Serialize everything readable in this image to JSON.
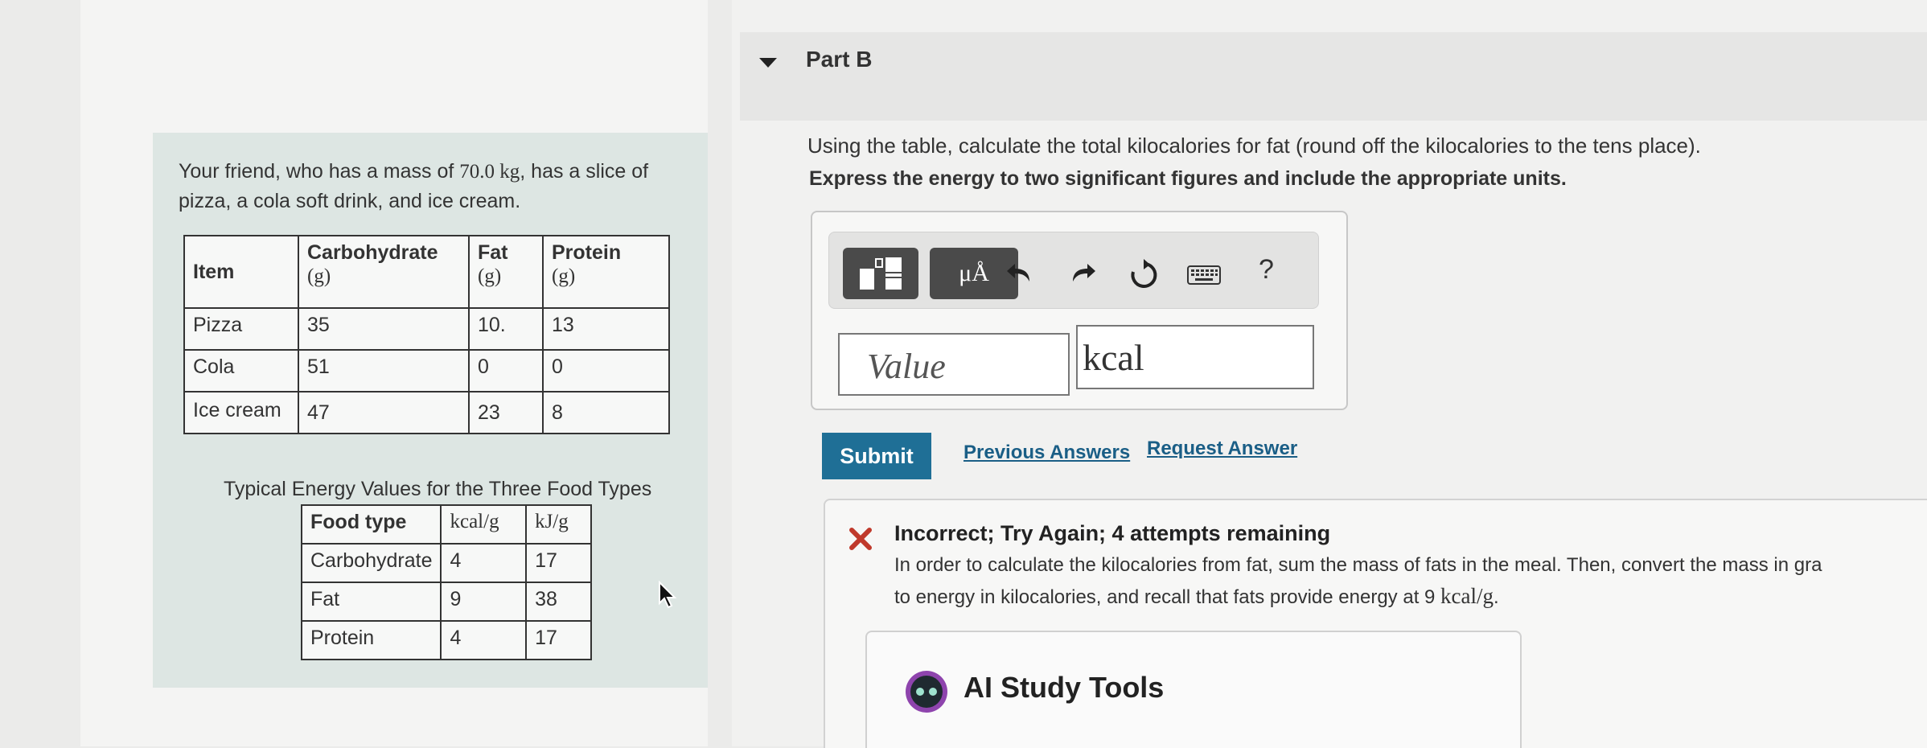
{
  "problem": {
    "intro_before": "Your friend, who has a mass of ",
    "intro_mass": "70.0 kg",
    "intro_after": ", has a slice of pizza, a cola soft drink, and ice cream.",
    "food_table": {
      "headers": [
        {
          "name": "Item",
          "unit": ""
        },
        {
          "name": "Carbohydrate",
          "unit": "(g)"
        },
        {
          "name": "Fat",
          "unit": "(g)"
        },
        {
          "name": "Protein",
          "unit": "(g)"
        }
      ],
      "rows": [
        [
          "Pizza",
          "35",
          "10.",
          "13"
        ],
        [
          "Cola",
          "51",
          "0",
          "0"
        ],
        [
          "Ice cream",
          "47",
          "23",
          "8"
        ]
      ]
    },
    "energy_caption": "Typical Energy Values for the Three Food Types",
    "energy_table": {
      "headers": [
        "Food type",
        "kcal/g",
        "kJ/g"
      ],
      "rows": [
        [
          "Carbohydrate",
          "4",
          "17"
        ],
        [
          "Fat",
          "9",
          "38"
        ],
        [
          "Protein",
          "4",
          "17"
        ]
      ]
    }
  },
  "part": {
    "title": "Part B",
    "question": "Using the table, calculate the total kilocalories for fat (round off the kilocalories to the tens place).",
    "instruction": "Express the energy to two significant figures and include the appropriate units."
  },
  "toolbar": {
    "units_label": "μÅ",
    "help_label": "?"
  },
  "answer": {
    "value_placeholder": "Value",
    "unit_value": "kcal"
  },
  "actions": {
    "submit_label": "Submit",
    "previous_answers_label": "Previous Answers",
    "request_answer_label": "Request Answer"
  },
  "feedback": {
    "title": "Incorrect; Try Again; 4 attempts remaining",
    "line1": "In order to calculate the kilocalories from fat, sum the mass of fats in the meal. Then, convert the mass in gra",
    "line2_before": "to energy in kilocalories, and recall that fats provide energy at 9 ",
    "line2_unit": "kcal/g",
    "line2_after": "."
  },
  "ai_tools": {
    "title": "AI Study Tools"
  },
  "colors": {
    "accent": "#1f6f96",
    "link": "#1a5e86",
    "error": "#c0392b",
    "panel": "#dde6e3"
  }
}
